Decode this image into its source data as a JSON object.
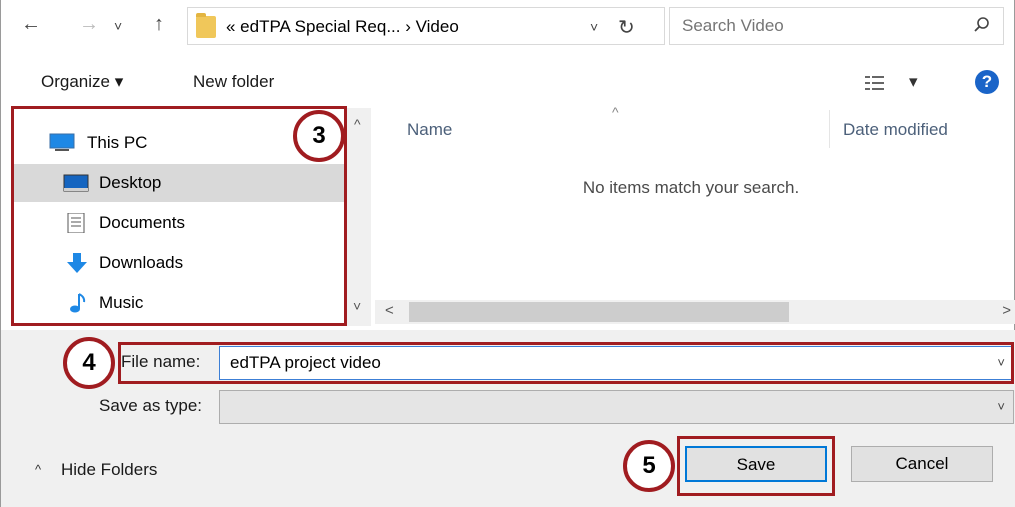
{
  "address_bar": {
    "back_glyph": "←",
    "forward_glyph": "→",
    "recent_glyph": "˅",
    "up_glyph": "↑",
    "path": "« edTPA Special Req... › Video",
    "dropdown_glyph": "˅",
    "refresh_glyph": "↻"
  },
  "search": {
    "placeholder": "Search Video"
  },
  "toolbar": {
    "organize_label": "Organize ▾",
    "new_folder_label": "New folder",
    "view_dropdown_glyph": "▾",
    "help_glyph": "?"
  },
  "nav_pane": {
    "items": [
      {
        "label": "This PC",
        "icon": "computer-icon"
      },
      {
        "label": "Desktop",
        "icon": "desktop-icon",
        "selected": true
      },
      {
        "label": "Documents",
        "icon": "documents-icon"
      },
      {
        "label": "Downloads",
        "icon": "downloads-icon"
      },
      {
        "label": "Music",
        "icon": "music-icon"
      }
    ],
    "scroll_up_glyph": "^",
    "scroll_down_glyph": "˅"
  },
  "content": {
    "sort_glyph": "^",
    "col_name": "Name",
    "col_date": "Date modified",
    "empty_message": "No items match your search.",
    "scroll_left_glyph": "<",
    "scroll_right_glyph": ">"
  },
  "form": {
    "filename_label": "File name:",
    "filename_value": "edTPA project video",
    "savetype_label": "Save as type:",
    "savetype_value": "",
    "chev_glyph": "˅"
  },
  "footer": {
    "hide_folders_label": "Hide Folders",
    "hide_folders_glyph": "^",
    "save_label": "Save",
    "cancel_label": "Cancel"
  },
  "annotations": {
    "step_3": "3",
    "step_4": "4",
    "step_5": "5",
    "color": "#a01c20"
  },
  "colors": {
    "selection": "#d9d9d9",
    "accent": "#0078d7",
    "help": "#1a64c8",
    "folder": "#f0c75a"
  }
}
